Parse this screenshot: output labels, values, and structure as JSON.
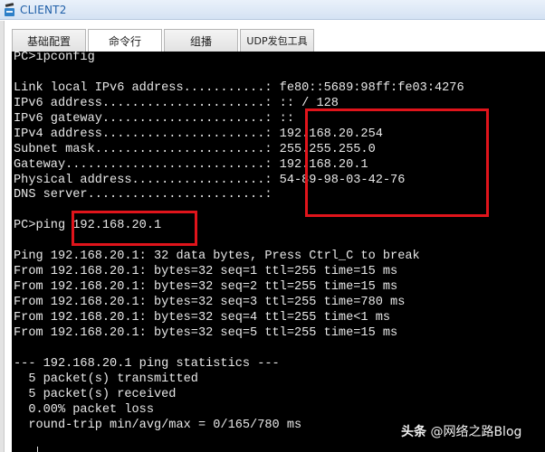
{
  "window": {
    "title": "CLIENT2",
    "icon": "client-pc-icon"
  },
  "tabs": [
    {
      "label": "基础配置",
      "active": false
    },
    {
      "label": "命令行",
      "active": true
    },
    {
      "label": "组播",
      "active": false
    },
    {
      "label": "UDP发包工具",
      "active": false
    }
  ],
  "console": {
    "lines": [
      "PC>ipconfig",
      "",
      "Link local IPv6 address...........: fe80::5689:98ff:fe03:4276",
      "IPv6 address......................: :: / 128",
      "IPv6 gateway......................: ::",
      "IPv4 address......................: 192.168.20.254",
      "Subnet mask.......................: 255.255.255.0",
      "Gateway...........................: 192.168.20.1",
      "Physical address..................: 54-89-98-03-42-76",
      "DNS server........................:",
      "",
      "PC>ping 192.168.20.1",
      "",
      "Ping 192.168.20.1: 32 data bytes, Press Ctrl_C to break",
      "From 192.168.20.1: bytes=32 seq=1 ttl=255 time=15 ms",
      "From 192.168.20.1: bytes=32 seq=2 ttl=255 time=15 ms",
      "From 192.168.20.1: bytes=32 seq=3 ttl=255 time=780 ms",
      "From 192.168.20.1: bytes=32 seq=4 ttl=255 time<1 ms",
      "From 192.168.20.1: bytes=32 seq=5 ttl=255 time=15 ms",
      "",
      "--- 192.168.20.1 ping statistics ---",
      "  5 packet(s) transmitted",
      "  5 packet(s) received",
      "  0.00% packet loss",
      "  round-trip min/avg/max = 0/165/780 ms",
      ""
    ]
  },
  "annotations": {
    "highlight_color": "#e0141b",
    "boxes": [
      "ipconfig-values-highlight",
      "ping-target-highlight"
    ]
  },
  "watermark": {
    "brand": "头条",
    "handle": "@网络之路Blog"
  }
}
